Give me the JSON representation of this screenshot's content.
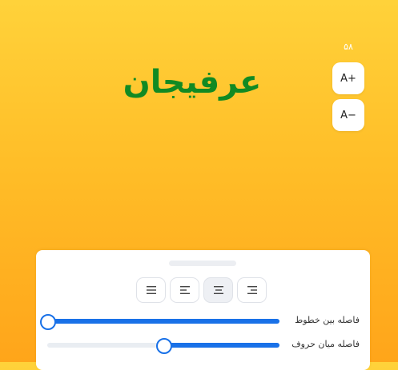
{
  "preview": {
    "text": "عرفیجان",
    "color": "#118a23"
  },
  "font_size": {
    "value": "۵۸",
    "increase_label": "A+",
    "decrease_label": "A−"
  },
  "panel": {
    "alignment": {
      "options": [
        "align-right",
        "align-center",
        "align-left",
        "justify"
      ],
      "selected": "align-center"
    },
    "line_height": {
      "label": "فاصله بین خطوط",
      "value_fraction": 0.0
    },
    "letter_spacing": {
      "label": "فاصله میان حروف",
      "value_fraction": 0.5
    }
  },
  "colors": {
    "accent": "#1971e8",
    "text_preview": "#118a23"
  }
}
